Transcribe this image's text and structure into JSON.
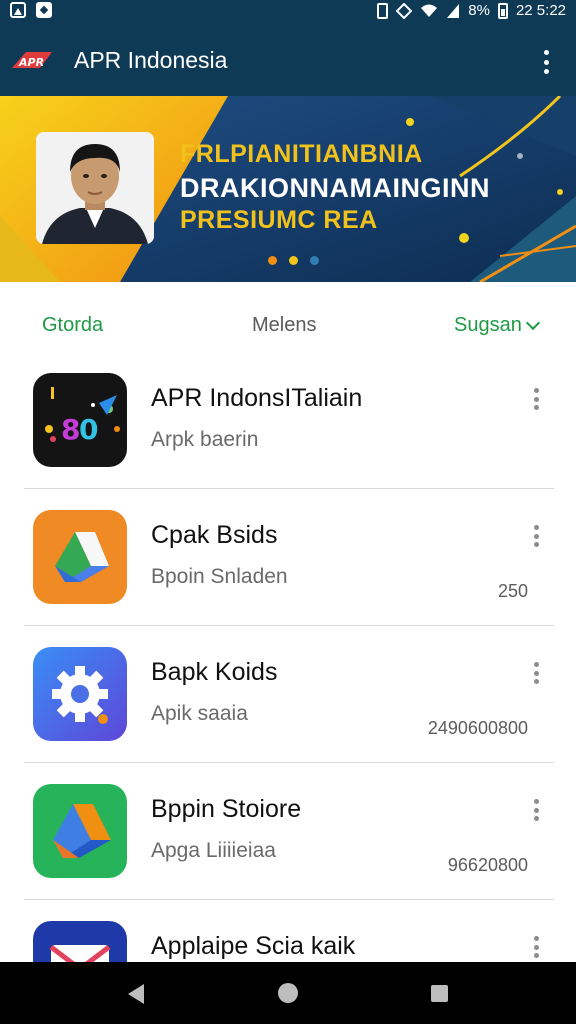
{
  "status_bar": {
    "battery": "8%",
    "time": "22 5:22",
    "icons": [
      "gallery-icon",
      "notification-icon",
      "vibrate-icon",
      "nfc-icon",
      "wifi-icon",
      "signal-icon",
      "battery-icon"
    ]
  },
  "app_bar": {
    "logo_text": "APR",
    "title": "APR Indonesia",
    "menu_icon": "overflow-menu-icon",
    "background": "#0f3a56"
  },
  "banner": {
    "line1": "FRLPIANITIANBNIA",
    "line2": "DRAKIONNAMAINGINN",
    "line3": "PRESIUMC REA",
    "colors": {
      "accent": "#f2c21c",
      "bg": "#123c66"
    },
    "pager": {
      "count": 3,
      "active": 1
    }
  },
  "tabs": [
    {
      "label": "Gtorda",
      "active": true
    },
    {
      "label": "Melens",
      "active": false
    },
    {
      "label": "Sugsan",
      "active": false
    }
  ],
  "apps": [
    {
      "title": "APR IndonsITaliain",
      "subtitle": "Arpk baerin",
      "meta": "",
      "icon": "colorful-app-icon"
    },
    {
      "title": "Cpak Bsids",
      "subtitle": "Bpoin Snladen",
      "meta": "250",
      "icon": "drive-orange-app-icon"
    },
    {
      "title": "Bapk Koids",
      "subtitle": "Apik saaia",
      "meta": "2490600800",
      "icon": "gear-app-icon"
    },
    {
      "title": "Bppin Stoiore",
      "subtitle": "Apga Liiiieiaa",
      "meta": "96620800",
      "icon": "drive-green-app-icon"
    },
    {
      "title": "Applaipe Scia kaik",
      "subtitle": "",
      "meta": "",
      "icon": "mail-app-icon"
    }
  ],
  "nav_bar": {
    "icons": [
      "back-icon",
      "home-icon",
      "recents-icon"
    ]
  }
}
